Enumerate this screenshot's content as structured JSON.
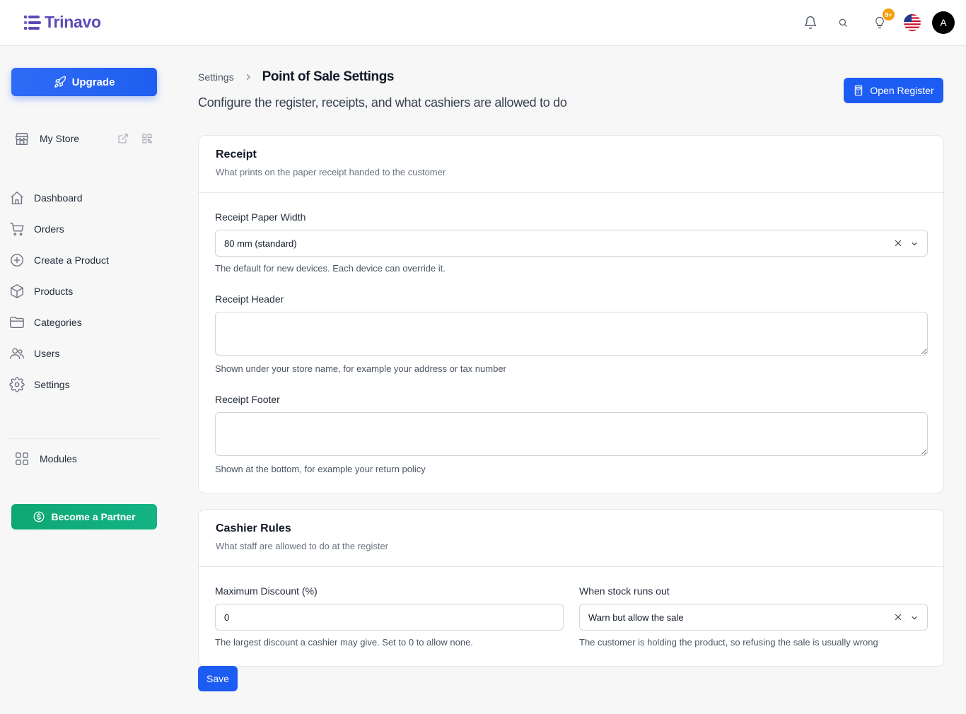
{
  "brand": {
    "name": "Trinavo",
    "color": "#5b4ab8"
  },
  "header": {
    "notifications_icon": "bell-icon",
    "search_icon": "search-icon",
    "tips_icon": "lightbulb-icon",
    "tips_badge": "9+",
    "language_icon": "us-flag-icon",
    "avatar_initial": "A"
  },
  "sidebar": {
    "upgrade_label": "Upgrade",
    "store_label": "My Store",
    "nav": [
      {
        "label": "Dashboard",
        "icon": "home-icon"
      },
      {
        "label": "Orders",
        "icon": "cart-icon"
      },
      {
        "label": "Create a Product",
        "icon": "plus-circle-icon"
      },
      {
        "label": "Products",
        "icon": "box-icon"
      },
      {
        "label": "Categories",
        "icon": "folder-icon"
      },
      {
        "label": "Users",
        "icon": "users-icon"
      },
      {
        "label": "Settings",
        "icon": "gear-icon"
      }
    ],
    "modules_label": "Modules",
    "partner_label": "Become a Partner"
  },
  "breadcrumb": {
    "parent": "Settings",
    "current": "Point of Sale Settings"
  },
  "page": {
    "subtitle": "Configure the register, receipts, and what cashiers are allowed to do",
    "open_register_label": "Open Register"
  },
  "receipt": {
    "title": "Receipt",
    "description": "What prints on the paper receipt handed to the customer",
    "paper_width_label": "Receipt Paper Width",
    "paper_width_value": "80 mm (standard)",
    "paper_width_help": "The default for new devices. Each device can override it.",
    "header_label": "Receipt Header",
    "header_value": "",
    "header_help": "Shown under your store name, for example your address or tax number",
    "footer_label": "Receipt Footer",
    "footer_value": "",
    "footer_help": "Shown at the bottom, for example your return policy"
  },
  "cashier": {
    "title": "Cashier Rules",
    "description": "What staff are allowed to do at the register",
    "max_discount_label": "Maximum Discount (%)",
    "max_discount_value": "0",
    "max_discount_help": "The largest discount a cashier may give. Set to 0 to allow none.",
    "stock_label": "When stock runs out",
    "stock_value": "Warn but allow the sale",
    "stock_help": "The customer is holding the product, so refusing the sale is usually wrong"
  },
  "save_label": "Save",
  "colors": {
    "primary": "#1d5cf2",
    "partner": "#0ea773",
    "badge": "#f59e0b"
  }
}
